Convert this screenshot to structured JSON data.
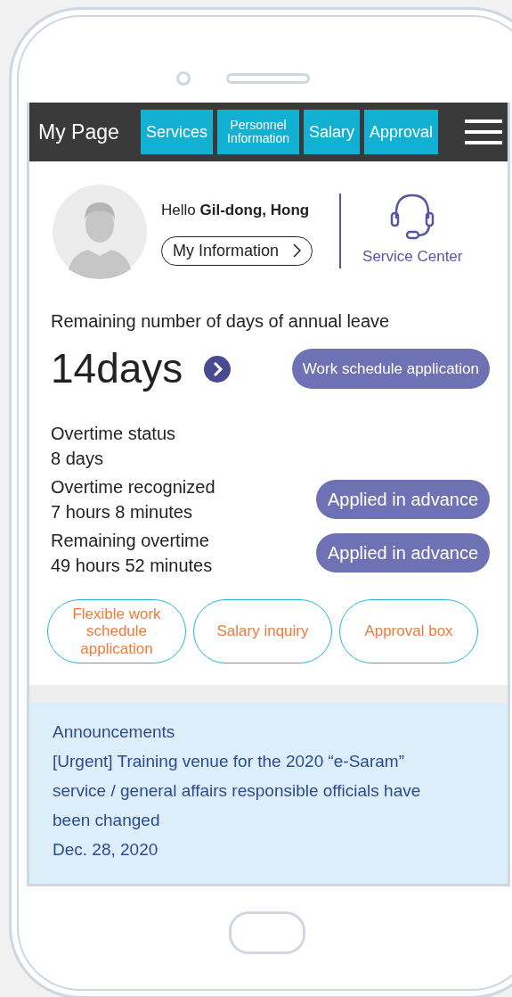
{
  "header": {
    "title": "My Page",
    "tabs": [
      {
        "label": "Services"
      },
      {
        "label": "Personnel Information",
        "small": true
      },
      {
        "label": "Salary"
      },
      {
        "label": "Approval"
      }
    ]
  },
  "profile": {
    "greeting": "Hello **Gil-dong, Hong**",
    "info_button": "My Information",
    "service_center": "Service Center"
  },
  "leave": {
    "label": "Remaining number of days of annual leave",
    "value": "14days",
    "button": "Work schedule application"
  },
  "overtime": [
    {
      "label": "Overtime status",
      "value": "8 days"
    },
    {
      "label": "Overtime recognized",
      "value": "7 hours 8 minutes",
      "button": "Applied in advance"
    },
    {
      "label": "Remaining overtime",
      "value": "49 hours 52 minutes",
      "button": "Applied in advance"
    }
  ],
  "quick_buttons": [
    "Flexible work schedule application",
    "Salary inquiry",
    "Approval box"
  ],
  "announcements": {
    "title": "Announcements",
    "text": "[Urgent] Training venue for the 2020 “e-Saram” service / general affairs responsible officials have been changed",
    "date": "Dec. 28, 2020"
  }
}
